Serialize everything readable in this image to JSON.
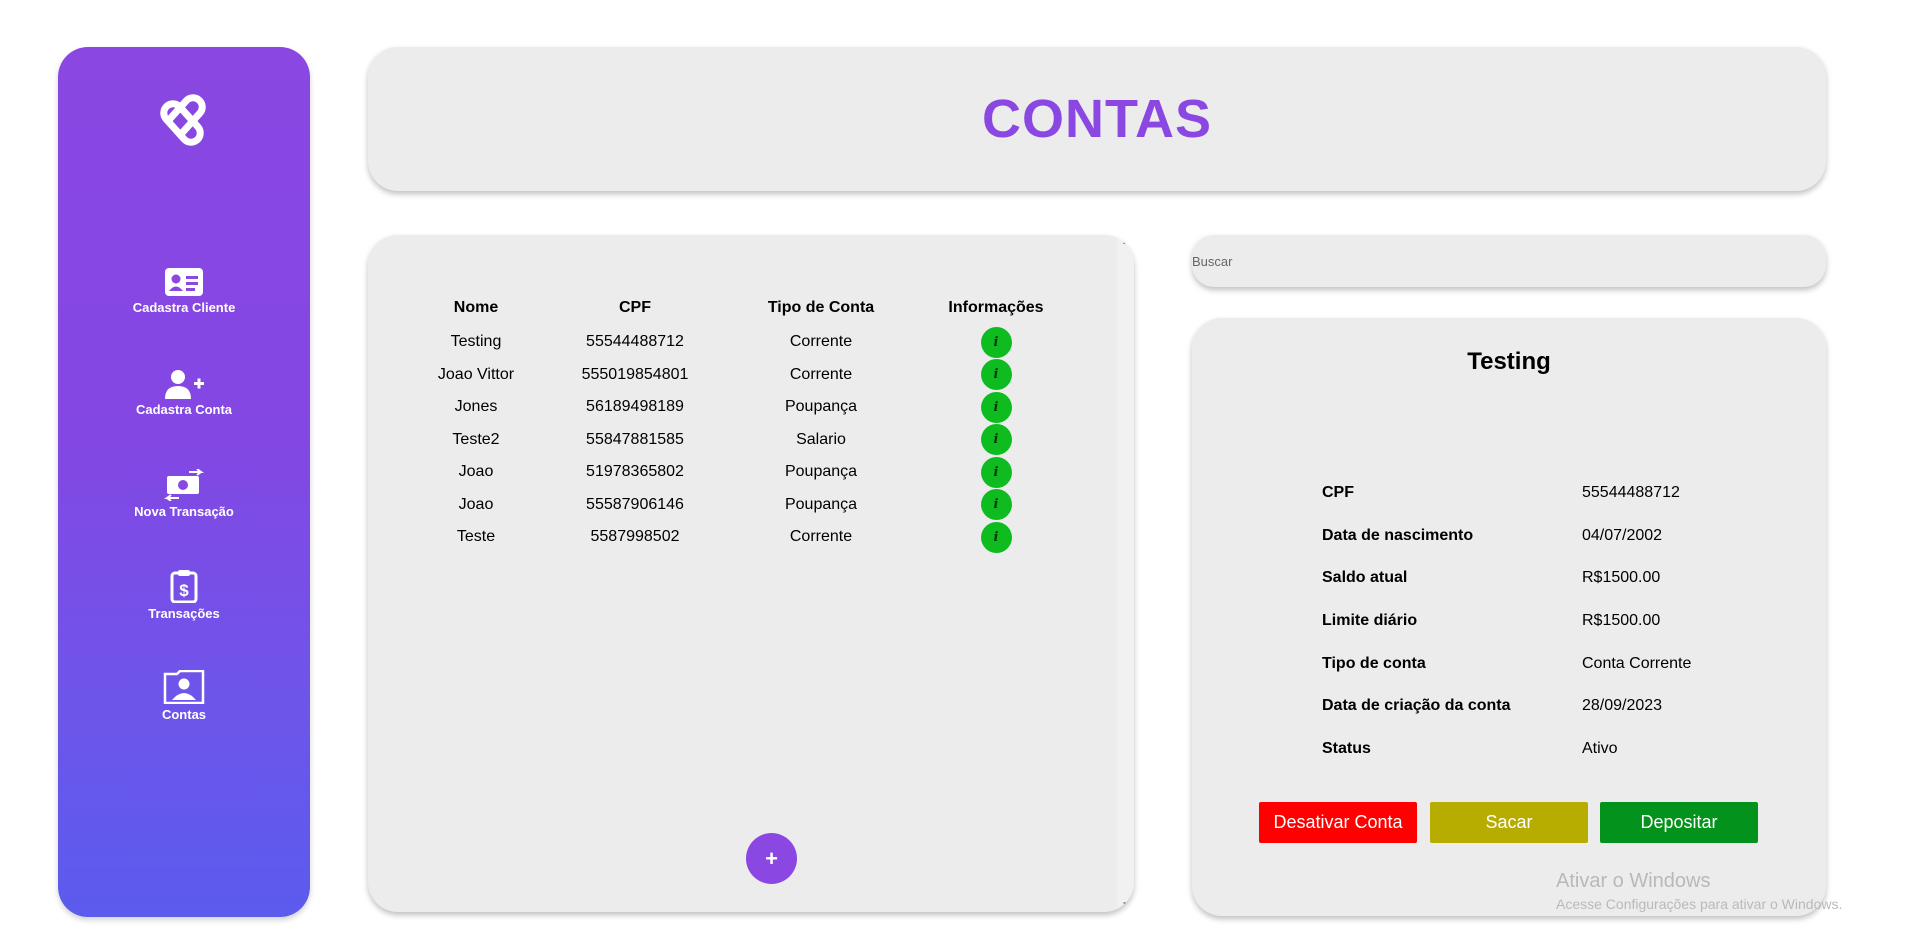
{
  "sidebar": {
    "items": [
      {
        "label": "Cadastra Cliente",
        "icon": "id-card-icon"
      },
      {
        "label": "Cadastra Conta",
        "icon": "user-plus-icon"
      },
      {
        "label": "Nova Transação",
        "icon": "money-transfer-icon"
      },
      {
        "label": "Transações",
        "icon": "clipboard-dollar-icon"
      },
      {
        "label": "Contas",
        "icon": "folder-user-icon"
      }
    ]
  },
  "header": {
    "title": "CONTAS"
  },
  "accounts_table": {
    "columns": [
      "Nome",
      "CPF",
      "Tipo de Conta",
      "Informações"
    ],
    "rows": [
      {
        "nome": "Testing",
        "cpf": "55544488712",
        "tipo": "Corrente",
        "info": "i"
      },
      {
        "nome": "Joao Vittor",
        "cpf": "555019854801",
        "tipo": "Corrente",
        "info": "i"
      },
      {
        "nome": "Jones",
        "cpf": "56189498189",
        "tipo": "Poupança",
        "info": "i"
      },
      {
        "nome": "Teste2",
        "cpf": "55847881585",
        "tipo": "Salario",
        "info": "i"
      },
      {
        "nome": "Joao",
        "cpf": "51978365802",
        "tipo": "Poupança",
        "info": "i"
      },
      {
        "nome": "Joao",
        "cpf": "55587906146",
        "tipo": "Poupança",
        "info": "i"
      },
      {
        "nome": "Teste",
        "cpf": "5587998502",
        "tipo": "Corrente",
        "info": "i"
      }
    ],
    "add_label": "+"
  },
  "search": {
    "placeholder": "Buscar"
  },
  "detail": {
    "title": "Testing",
    "fields": [
      {
        "label": "CPF",
        "value": "55544488712"
      },
      {
        "label": "Data de nascimento",
        "value": "04/07/2002"
      },
      {
        "label": "Saldo atual",
        "value": "R$1500.00"
      },
      {
        "label": "Limite diário",
        "value": "R$1500.00"
      },
      {
        "label": "Tipo de conta",
        "value": "Conta Corrente"
      },
      {
        "label": "Data de criação da conta",
        "value": "28/09/2023"
      },
      {
        "label": "Status",
        "value": "Ativo"
      }
    ],
    "buttons": {
      "deactivate": "Desativar Conta",
      "withdraw": "Sacar",
      "deposit": "Depositar"
    }
  },
  "watermark": {
    "title": "Ativar o Windows",
    "subtitle": "Acesse Configurações para ativar o Windows."
  },
  "colors": {
    "accent": "#8a47e2",
    "info_button": "#0fbc1f",
    "deactivate": "#fe0000",
    "withdraw": "#b7ac00",
    "deposit": "#03921b",
    "panel": "#ececec"
  }
}
